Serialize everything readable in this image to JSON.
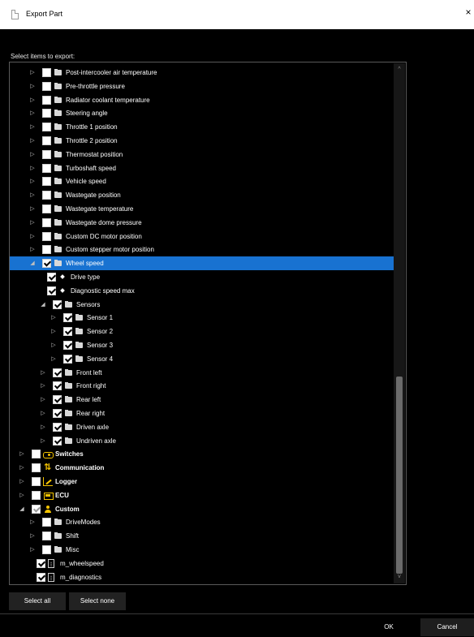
{
  "window": {
    "title": "Export Part",
    "close_glyph": "×"
  },
  "dialog": {
    "select_label": "Select items to export:"
  },
  "tree": {
    "rows": [
      {
        "label": "Post-intercooler air temperature",
        "level": 0,
        "expander": "collapsed",
        "check": "none",
        "icon": "folder-icon",
        "bold": false
      },
      {
        "label": "Pre-throttle pressure",
        "level": 0,
        "expander": "collapsed",
        "check": "none",
        "icon": "folder-icon",
        "bold": false
      },
      {
        "label": "Radiator coolant temperature",
        "level": 0,
        "expander": "collapsed",
        "check": "none",
        "icon": "folder-icon",
        "bold": false
      },
      {
        "label": "Steering angle",
        "level": 0,
        "expander": "collapsed",
        "check": "none",
        "icon": "folder-icon",
        "bold": false
      },
      {
        "label": "Throttle 1 position",
        "level": 0,
        "expander": "collapsed",
        "check": "none",
        "icon": "folder-icon",
        "bold": false
      },
      {
        "label": "Throttle 2 position",
        "level": 0,
        "expander": "collapsed",
        "check": "none",
        "icon": "folder-icon",
        "bold": false
      },
      {
        "label": "Thermostat position",
        "level": 0,
        "expander": "collapsed",
        "check": "none",
        "icon": "folder-icon",
        "bold": false
      },
      {
        "label": "Turboshaft speed",
        "level": 0,
        "expander": "collapsed",
        "check": "none",
        "icon": "folder-icon",
        "bold": false
      },
      {
        "label": "Vehicle speed",
        "level": 0,
        "expander": "collapsed",
        "check": "none",
        "icon": "folder-icon",
        "bold": false
      },
      {
        "label": "Wastegate position",
        "level": 0,
        "expander": "collapsed",
        "check": "none",
        "icon": "folder-icon",
        "bold": false
      },
      {
        "label": "Wastegate temperature",
        "level": 0,
        "expander": "collapsed",
        "check": "none",
        "icon": "folder-icon",
        "bold": false
      },
      {
        "label": "Wastegate dome pressure",
        "level": 0,
        "expander": "collapsed",
        "check": "none",
        "icon": "folder-icon",
        "bold": false
      },
      {
        "label": "Custom DC motor position",
        "level": 0,
        "expander": "collapsed",
        "check": "none",
        "icon": "folder-icon",
        "bold": false
      },
      {
        "label": "Custom stepper motor position",
        "level": 0,
        "expander": "collapsed",
        "check": "none",
        "icon": "folder-icon",
        "bold": false
      },
      {
        "label": "Wheel speed",
        "level": 0,
        "expander": "expanded",
        "check": "checked",
        "icon": "folder-icon",
        "bold": false,
        "selected": true
      },
      {
        "label": "Drive type",
        "level": 1,
        "expander": "none",
        "check": "checked",
        "icon": "diamond-icon",
        "bold": false
      },
      {
        "label": "Diagnostic speed max",
        "level": 1,
        "expander": "none",
        "check": "checked",
        "icon": "diamond-icon",
        "bold": false
      },
      {
        "label": "Sensors",
        "level": 1,
        "expander": "expanded",
        "check": "checked",
        "icon": "folder-icon",
        "bold": false
      },
      {
        "label": "Sensor 1",
        "level": 2,
        "expander": "collapsed",
        "check": "checked",
        "icon": "folder-icon",
        "bold": false
      },
      {
        "label": "Sensor 2",
        "level": 2,
        "expander": "collapsed",
        "check": "checked",
        "icon": "folder-icon",
        "bold": false
      },
      {
        "label": "Sensor 3",
        "level": 2,
        "expander": "collapsed",
        "check": "checked",
        "icon": "folder-icon",
        "bold": false
      },
      {
        "label": "Sensor 4",
        "level": 2,
        "expander": "collapsed",
        "check": "checked",
        "icon": "folder-icon",
        "bold": false
      },
      {
        "label": "Front left",
        "level": 1,
        "expander": "collapsed",
        "check": "checked",
        "icon": "folder-icon",
        "bold": false
      },
      {
        "label": "Front right",
        "level": 1,
        "expander": "collapsed",
        "check": "checked",
        "icon": "folder-icon",
        "bold": false
      },
      {
        "label": "Rear left",
        "level": 1,
        "expander": "collapsed",
        "check": "checked",
        "icon": "folder-icon",
        "bold": false
      },
      {
        "label": "Rear right",
        "level": 1,
        "expander": "collapsed",
        "check": "checked",
        "icon": "folder-icon",
        "bold": false
      },
      {
        "label": "Driven axle",
        "level": 1,
        "expander": "collapsed",
        "check": "checked",
        "icon": "folder-icon",
        "bold": false
      },
      {
        "label": "Undriven axle",
        "level": 1,
        "expander": "collapsed",
        "check": "checked",
        "icon": "folder-icon",
        "bold": false
      },
      {
        "label": "Switches",
        "level": -1,
        "expander": "collapsed",
        "check": "none",
        "icon": "switch-icon",
        "bold": true
      },
      {
        "label": "Communication",
        "level": -1,
        "expander": "collapsed",
        "check": "none",
        "icon": "comm-icon",
        "bold": true
      },
      {
        "label": "Logger",
        "level": -1,
        "expander": "collapsed",
        "check": "none",
        "icon": "logger-icon",
        "bold": true
      },
      {
        "label": "ECU",
        "level": -1,
        "expander": "collapsed",
        "check": "none",
        "icon": "ecu-icon",
        "bold": true
      },
      {
        "label": "Custom",
        "level": -1,
        "expander": "expanded",
        "check": "partial",
        "icon": "custom-icon",
        "bold": true
      },
      {
        "label": "DriveModes",
        "level": 0,
        "expander": "collapsed",
        "check": "none",
        "icon": "folder-icon",
        "bold": false
      },
      {
        "label": "Shift",
        "level": 0,
        "expander": "collapsed",
        "check": "none",
        "icon": "folder-icon",
        "bold": false
      },
      {
        "label": "Misc",
        "level": 0,
        "expander": "collapsed",
        "check": "none",
        "icon": "folder-icon",
        "bold": false
      },
      {
        "label": "m_wheelspeed",
        "level": 0,
        "expander": "none",
        "check": "checked",
        "icon": "var-icon",
        "bold": false
      },
      {
        "label": "m_diagnostics",
        "level": 0,
        "expander": "none",
        "check": "checked",
        "icon": "var-icon",
        "bold": false
      }
    ]
  },
  "buttons": {
    "select_all": "Select all",
    "select_none": "Select none",
    "ok": "OK",
    "cancel": "Cancel"
  },
  "colors": {
    "selection": "#1872d1",
    "accent_icon": "#f5c400",
    "background": "#000000"
  }
}
